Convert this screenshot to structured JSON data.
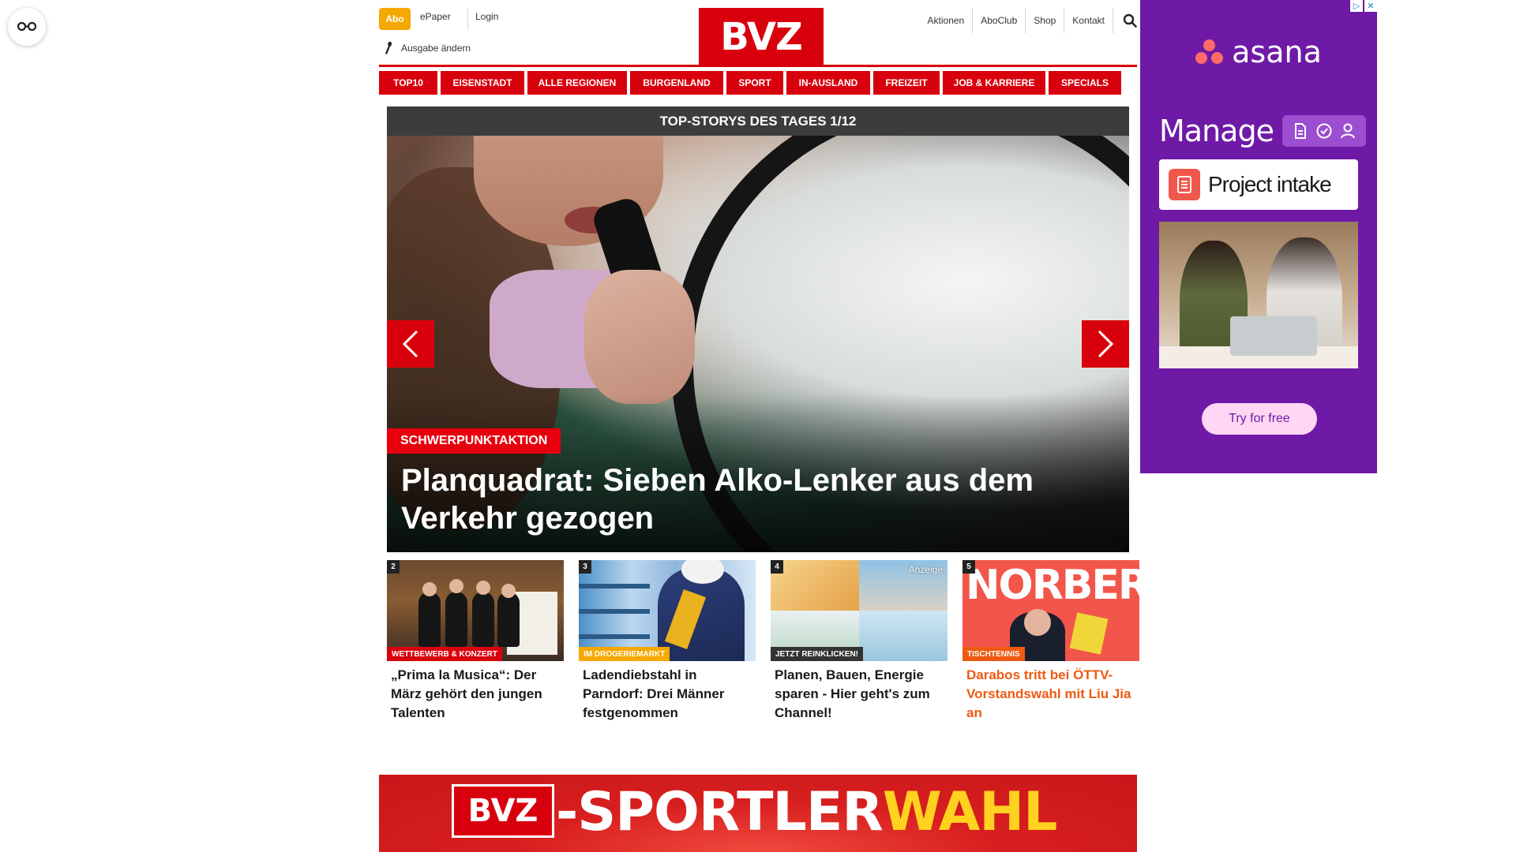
{
  "header": {
    "abo_label": "Abo",
    "epaper_label": "ePaper",
    "login_label": "Login",
    "edition_label": "Ausgabe ändern",
    "logo_text": "BVZ",
    "links": [
      "Aktionen",
      "AboClub",
      "Shop",
      "Kontakt"
    ]
  },
  "nav": {
    "items": [
      "TOP10",
      "EISENSTADT",
      "ALLE REGIONEN",
      "BURGENLAND",
      "SPORT",
      "IN-AUSLAND",
      "FREIZEIT",
      "JOB & KARRIERE",
      "SPECIALS"
    ]
  },
  "slider": {
    "heading": "TOP-STORYS DES TAGES 1/12",
    "main": {
      "kicker": "SCHWERPUNKTAKTION",
      "title": "Planquadrat: Sieben Alko-Lenker aus dem Verkehr gezogen"
    },
    "cards": [
      {
        "num": "2",
        "kicker": "WETTBEWERB & KONZERT",
        "kicker_color": "#d9000d",
        "title": "„Prima la Musica“: Der März gehört den jungen Talenten",
        "title_color": "#1a1a1a"
      },
      {
        "num": "3",
        "kicker": "IM DROGERIEMARKT",
        "kicker_color": "#f5a800",
        "title": "Ladendiebstahl in Parndorf: Drei Männer festgenommen",
        "title_color": "#1a1a1a"
      },
      {
        "num": "4",
        "kicker": "JETZT REINKLICKEN!",
        "kicker_color": "#333333",
        "badge": "Anzeige",
        "title": "Planen, Bauen, Energie sparen - Hier geht's zum Channel!",
        "title_color": "#1a1a1a"
      },
      {
        "num": "5",
        "kicker": "TISCHTENNIS",
        "kicker_color": "#ee5a10",
        "image_text": "NORBERT",
        "title": "Darabos tritt bei ÖTTV-Vorstandswahl mit Liu Jia an",
        "title_color": "#ee5a10"
      }
    ]
  },
  "banner": {
    "logo": "BVZ",
    "text_white": "-SPORTLER",
    "text_yellow": "WAHL"
  },
  "ad": {
    "brand": "asana",
    "headline": "Manage",
    "product": "Project intake",
    "cta": "Try for free",
    "adchoices": [
      "▷",
      "✕"
    ]
  },
  "colors": {
    "brand_red": "#d9000d",
    "abo_yellow": "#f5a800",
    "teaser_orange": "#ee5a10",
    "ad_purple": "#6e1aa6"
  }
}
